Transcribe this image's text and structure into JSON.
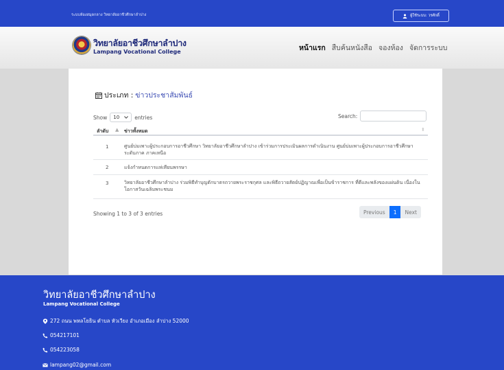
{
  "topbar": {
    "site_name": "ระบบห้องสมุดกลาง วิทยาลัยอาชีวศึกษาลำปาง",
    "user_label": "ผู้ใช้ระบบ: วรศักดิ์"
  },
  "header": {
    "brand_th": "วิทยาลัยอาชีวศึกษาลำปาง",
    "brand_en": "Lampang Vocational College",
    "nav": [
      "หน้าแรก",
      "สืบค้นหนังสือ",
      "จองห้อง",
      "จัดการระบบ"
    ]
  },
  "content": {
    "category_label": "ประเภท :",
    "category_value": "ข่าวประชาสัมพันธ์",
    "show_label": "Show",
    "entries_value": "10",
    "entries_label": "entries",
    "search_label": "Search:",
    "search_placeholder": "",
    "columns": [
      "ลำดับ",
      "ข่าวทั้งหมด"
    ],
    "rows": [
      {
        "no": "1",
        "title": "ศูนย์บ่มเพาะผู้ประกอบการอาชีวศึกษา วิทยาลัยอาชีวศึกษาลำปาง เข้าร่วมการประเมินผลการดำเนินงาน ศูนย์บ่มเพาะผู้ประกอบการอาชีวศึกษา ระดับภาค ภาคเหนือ"
      },
      {
        "no": "2",
        "title": "แจ้งกำหนดการแห่เทียนพรรษา"
      },
      {
        "no": "3",
        "title": "วิทยาลัยอาชีวศึกษาลำปาง ร่วมพิธีทำบุญตักบาตรถวายพระราชกุศล และพิธีถวายสัตย์ปฏิญาณเพื่อเป็นข้าราชการ ที่ดีและพลังของแผ่นดิน เนื่องในโอกาสวันเฉลิมพระชนม"
      }
    ],
    "info": "Showing 1 to 3 of 3 entries",
    "pager": {
      "previous": "Previous",
      "current": "1",
      "next": "Next"
    }
  },
  "footer": {
    "title": "วิทยาลัยอาชีวศึกษาลำปาง",
    "subtitle": "Lampang Vocational College",
    "address": "272 ถนน พหลโยธิน ตำบล หัวเวียง อำเภอเมือง ลำปาง 52000",
    "phone1": "054217101",
    "phone2": "054223058",
    "email": "lampang02@gmail.com"
  }
}
